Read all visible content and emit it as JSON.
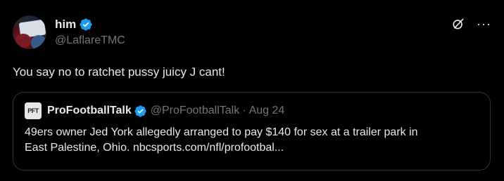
{
  "post": {
    "author": {
      "display_name": "him",
      "handle": "@LaflareTMC",
      "verified": true
    },
    "text": "You say no to ratchet pussy juicy J cant!",
    "actions": {
      "grok_icon": "grok-slash-circle-icon",
      "more_label": "···"
    }
  },
  "quote": {
    "avatar_text": "PFT",
    "display_name": "ProFootballTalk",
    "handle": "@ProFootballTalk",
    "separator": "·",
    "date": "Aug 24",
    "verified": true,
    "text_line1": "49ers owner Jed York allegedly arranged to pay $140 for sex at a trailer park in",
    "text_line2": "East Palestine, Ohio. nbcsports.com/nfl/profootbal..."
  },
  "colors": {
    "background": "#000000",
    "text_primary": "#e7e9ea",
    "text_secondary": "#71767b",
    "verified_blue": "#1d9bf0",
    "border": "#2f3336"
  }
}
